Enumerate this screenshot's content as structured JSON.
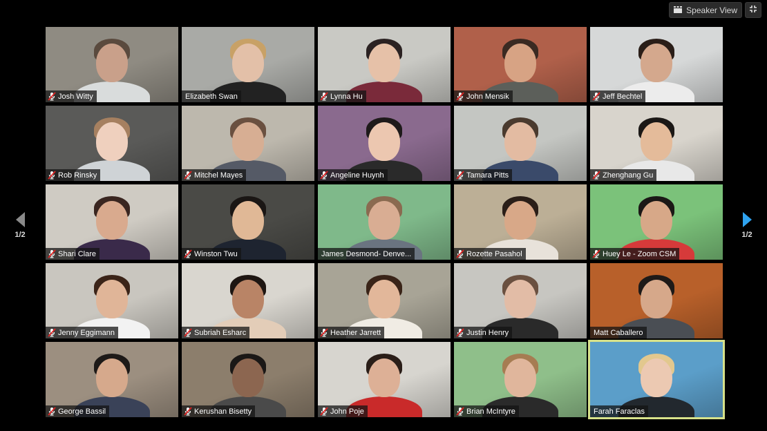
{
  "toolbar": {
    "speaker_view_label": "Speaker View",
    "speaker_view_icon": "grid-layout-icon",
    "fullscreen_icon": "fullscreen-icon"
  },
  "pagination": {
    "prev_label": "1/2",
    "next_label": "1/2",
    "prev_icon": "triangle-left-icon",
    "next_icon": "triangle-right-icon",
    "active_color": "#2fa3f0",
    "inactive_color": "#8a8a8a"
  },
  "active_speaker_border_color": "#d7e28a",
  "participants": [
    {
      "name": "Josh Witty",
      "muted": true,
      "bg": "#8f8b82",
      "skin": "#c9a08a",
      "shirt": "#d9dcdc",
      "hair": "#5a4a3e"
    },
    {
      "name": "Elizabeth Swan",
      "muted": false,
      "bg": "#a9aaa6",
      "skin": "#e3c0a8",
      "shirt": "#222",
      "hair": "#c8a166"
    },
    {
      "name": "Lynna Hu",
      "muted": true,
      "bg": "#c9c9c4",
      "skin": "#e6c1a8",
      "shirt": "#7a2a3a",
      "hair": "#2b2222"
    },
    {
      "name": "John Mensik",
      "muted": true,
      "bg": "#b0604a",
      "skin": "#d7a384",
      "shirt": "#5c5f5a",
      "hair": "#3a2a22"
    },
    {
      "name": "Jeff Bechtel",
      "muted": true,
      "bg": "#d6d8d8",
      "skin": "#d4a88d",
      "shirt": "#ececec",
      "hair": "#2a1e18"
    },
    {
      "name": "Rob Rinsky",
      "muted": true,
      "bg": "#5a5a58",
      "skin": "#efd0be",
      "shirt": "#cfd3d6",
      "hair": "#a68060"
    },
    {
      "name": "Mitchel Mayes",
      "muted": true,
      "bg": "#bdb8ad",
      "skin": "#d7ae93",
      "shirt": "#555a66",
      "hair": "#6a5040"
    },
    {
      "name": "Angeline Huynh",
      "muted": true,
      "bg": "#8a6a8e",
      "skin": "#ecc7b0",
      "shirt": "#2a2a2a",
      "hair": "#1e1a1a"
    },
    {
      "name": "Tamara Pitts",
      "muted": true,
      "bg": "#c4c6c2",
      "skin": "#e3bba2",
      "shirt": "#3a4a6a",
      "hair": "#4a3a2e"
    },
    {
      "name": "Zhenghang Gu",
      "muted": true,
      "bg": "#d8d4cc",
      "skin": "#e4bb9a",
      "shirt": "#e8e8e8",
      "hair": "#1b1816"
    },
    {
      "name": "Shari Clare",
      "muted": true,
      "bg": "#cfcbc3",
      "skin": "#d9aa8e",
      "shirt": "#3a2a4a",
      "hair": "#3a2620"
    },
    {
      "name": "Winston Twu",
      "muted": true,
      "bg": "#4a4a46",
      "skin": "#e0b896",
      "shirt": "#1e2430",
      "hair": "#1a1614"
    },
    {
      "name": "James Desmond- Denve...",
      "muted": false,
      "bg": "#7fb98a",
      "skin": "#d9ad93",
      "shirt": "#6a7480",
      "hair": "#8a6a50"
    },
    {
      "name": "Rozette Pasahol",
      "muted": true,
      "bg": "#bcaf96",
      "skin": "#d8a888",
      "shirt": "#e8e2da",
      "hair": "#2a1e18"
    },
    {
      "name": "Huey Le - Zoom CSM",
      "muted": true,
      "bg": "#7bc27a",
      "skin": "#d7a888",
      "shirt": "#d63a3a",
      "hair": "#1b1816"
    },
    {
      "name": "Jenny Eggimann",
      "muted": true,
      "bg": "#c9c6bf",
      "skin": "#e0b598",
      "shirt": "#f2f2f2",
      "hair": "#3b2418"
    },
    {
      "name": "Subriah Esharc",
      "muted": true,
      "bg": "#d9d6cf",
      "skin": "#b98466",
      "shirt": "#e3cdb8",
      "hair": "#1e1612"
    },
    {
      "name": "Heather Jarrett",
      "muted": true,
      "bg": "#a8a496",
      "skin": "#e2b79a",
      "shirt": "#f0ece4",
      "hair": "#3a2418"
    },
    {
      "name": "Justin Henry",
      "muted": true,
      "bg": "#c7c6c1",
      "skin": "#e2bca6",
      "shirt": "#2a2a2a",
      "hair": "#6a5040"
    },
    {
      "name": "Matt Caballero",
      "muted": false,
      "bg": "#b8602a",
      "skin": "#d6a88a",
      "shirt": "#4a4e54",
      "hair": "#1e1a18"
    },
    {
      "name": "George Bassil",
      "muted": true,
      "bg": "#9c8f80",
      "skin": "#d6a98c",
      "shirt": "#3a4258",
      "hair": "#1e1a18"
    },
    {
      "name": "Kerushan Bisetty",
      "muted": true,
      "bg": "#8c7e6c",
      "skin": "#8c6650",
      "shirt": "#4a4a4a",
      "hair": "#1b1816"
    },
    {
      "name": "John Poje",
      "muted": true,
      "bg": "#d7d5cf",
      "skin": "#ddb096",
      "shirt": "#c92a2a",
      "hair": "#2a1e18"
    },
    {
      "name": "Brian McIntyre",
      "muted": true,
      "bg": "#8fbf8a",
      "skin": "#e0b69c",
      "shirt": "#2a2a2a",
      "hair": "#a67c52"
    },
    {
      "name": "Farah Faraclas",
      "muted": false,
      "active": true,
      "bg": "#5b9ec9",
      "skin": "#ecc9b2",
      "shirt": "#22282e",
      "hair": "#e2c88e"
    }
  ]
}
